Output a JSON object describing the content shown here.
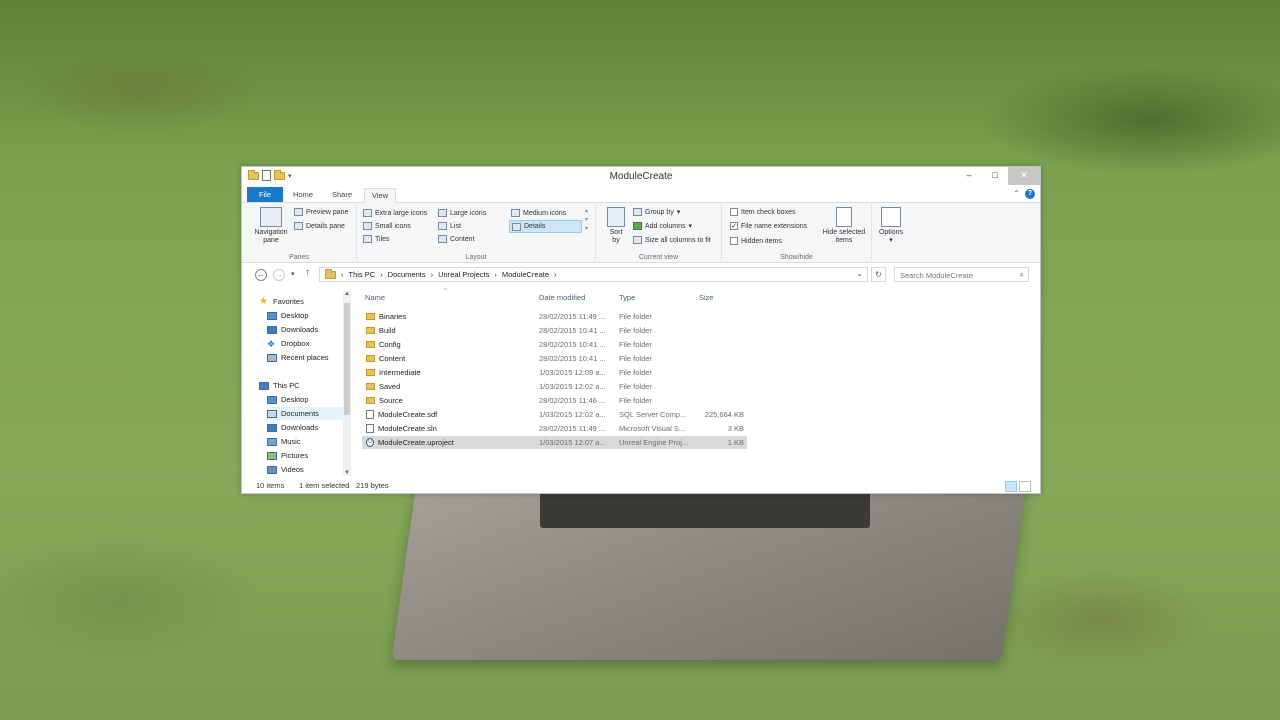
{
  "window": {
    "title": "ModuleCreate"
  },
  "tabs": [
    "File",
    "Home",
    "Share",
    "View"
  ],
  "ribbon": {
    "panes": {
      "label": "Panes",
      "navigation_pane": "Navigation pane",
      "preview_pane": "Preview pane",
      "details_pane": "Details pane"
    },
    "layout": {
      "label": "Layout",
      "extra_large_icons": "Extra large icons",
      "large_icons": "Large icons",
      "medium_icons": "Medium icons",
      "small_icons": "Small icons",
      "list": "List",
      "details": "Details",
      "tiles": "Tiles",
      "content": "Content"
    },
    "current_view": {
      "label": "Current view",
      "sort_by": "Sort by",
      "group_by": "Group by",
      "add_columns": "Add columns",
      "size_all_columns": "Size all columns to fit"
    },
    "show_hide": {
      "label": "Show/hide",
      "item_check_boxes": "Item check boxes",
      "file_name_extensions": "File name extensions",
      "hidden_items": "Hidden items",
      "hide_selected_items": "Hide selected items",
      "item_check_boxes_checked": false,
      "file_name_extensions_checked": true,
      "hidden_items_checked": false
    },
    "options": "Options"
  },
  "address": {
    "breadcrumb": [
      "This PC",
      "Documents",
      "Unreal Projects",
      "ModuleCreate"
    ],
    "search_placeholder": "Search ModuleCreate"
  },
  "nav": {
    "favorites": "Favorites",
    "fav_items": [
      "Desktop",
      "Downloads",
      "Dropbox",
      "Recent places"
    ],
    "this_pc": "This PC",
    "pc_items": [
      "Desktop",
      "Documents",
      "Downloads",
      "Music",
      "Pictures",
      "Videos"
    ],
    "selected": "Documents"
  },
  "columns": {
    "name": "Name",
    "date": "Date modified",
    "type": "Type",
    "size": "Size"
  },
  "files": [
    {
      "name": "Binaries",
      "date": "28/02/2015 11:49 ...",
      "type": "File folder",
      "size": "",
      "kind": "folder"
    },
    {
      "name": "Build",
      "date": "28/02/2015 10:41 ...",
      "type": "File folder",
      "size": "",
      "kind": "folder"
    },
    {
      "name": "Config",
      "date": "28/02/2015 10:41 ...",
      "type": "File folder",
      "size": "",
      "kind": "folder"
    },
    {
      "name": "Content",
      "date": "28/02/2015 10:41 ...",
      "type": "File folder",
      "size": "",
      "kind": "folder"
    },
    {
      "name": "Intermediate",
      "date": "1/03/2015 12:09 a...",
      "type": "File folder",
      "size": "",
      "kind": "folder"
    },
    {
      "name": "Saved",
      "date": "1/03/2015 12:02 a...",
      "type": "File folder",
      "size": "",
      "kind": "folder"
    },
    {
      "name": "Source",
      "date": "28/02/2015 11:46 ...",
      "type": "File folder",
      "size": "",
      "kind": "folder"
    },
    {
      "name": "ModuleCreate.sdf",
      "date": "1/03/2015 12:02 a...",
      "type": "SQL Server Comp...",
      "size": "225,664 KB",
      "kind": "file"
    },
    {
      "name": "ModuleCreate.sln",
      "date": "28/02/2015 11:49 ...",
      "type": "Microsoft Visual S...",
      "size": "3 KB",
      "kind": "file"
    },
    {
      "name": "ModuleCreate.uproject",
      "date": "1/03/2015 12:07 a...",
      "type": "Unreal Engine Proj...",
      "size": "1 KB",
      "kind": "uproject"
    }
  ],
  "status": {
    "items": "10 items",
    "selected": "1 item selected",
    "bytes": "219 bytes"
  }
}
